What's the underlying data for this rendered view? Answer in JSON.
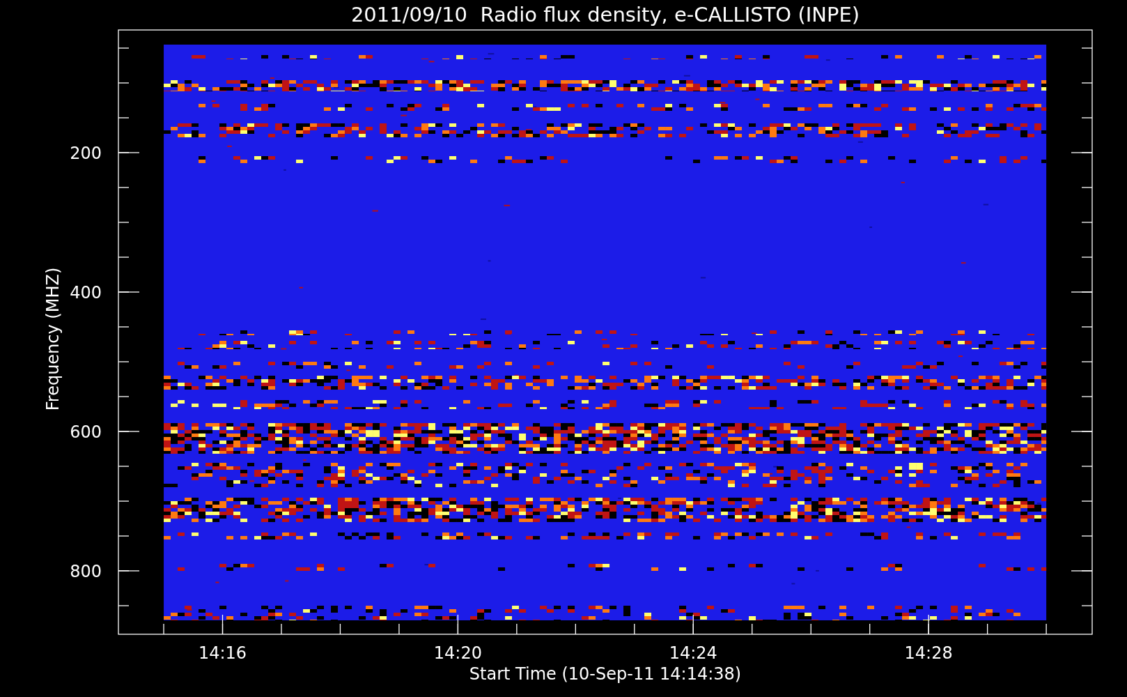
{
  "title": "2011/09/10  Radio flux density, e-CALLISTO (INPE)",
  "x_axis": {
    "label": "Start Time (10-Sep-11 14:14:38)",
    "tick_labels": [
      "14:16",
      "14:20",
      "14:24",
      "14:28"
    ]
  },
  "y_axis": {
    "label": "Frequency (MHZ)",
    "tick_labels": [
      "200",
      "400",
      "600",
      "800"
    ]
  }
}
